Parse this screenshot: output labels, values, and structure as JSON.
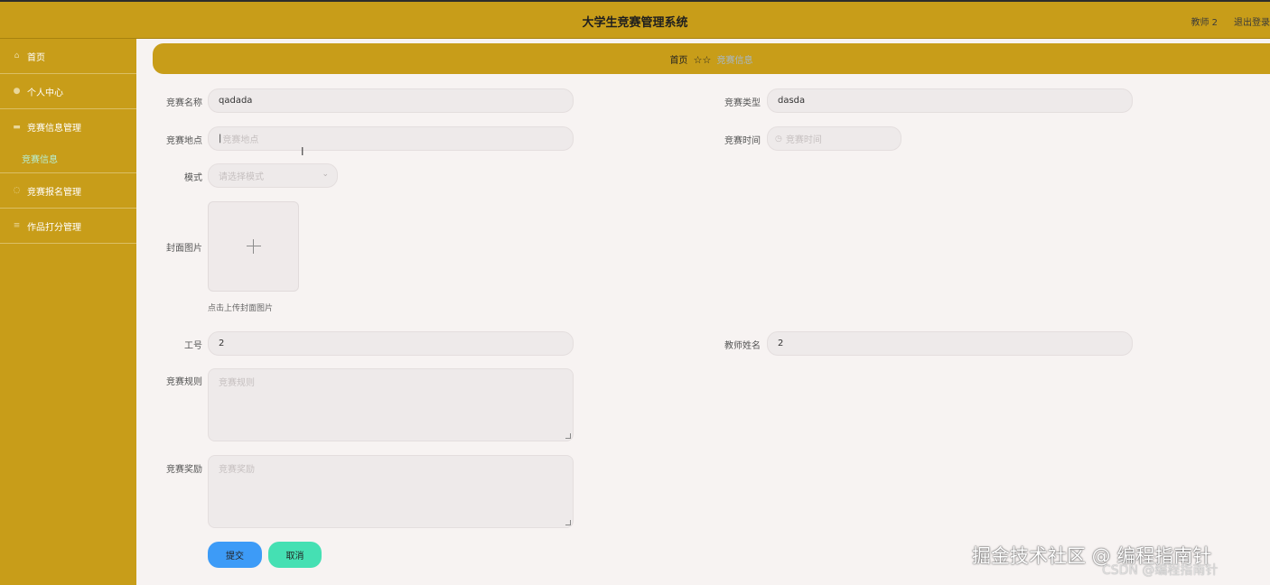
{
  "header": {
    "title": "大学生竞赛管理系统",
    "user": "教师 2",
    "logout": "退出登录"
  },
  "sidebar": {
    "items": [
      {
        "label": "首页",
        "icon": "home-icon"
      },
      {
        "label": "个人中心",
        "icon": "user-icon"
      },
      {
        "label": "竞赛信息管理",
        "icon": "list-icon"
      },
      {
        "label": "竞赛信息",
        "icon": ""
      },
      {
        "label": "竞赛报名管理",
        "icon": "clipboard-icon"
      },
      {
        "label": "作品打分管理",
        "icon": "score-icon"
      }
    ]
  },
  "breadcrumb": {
    "home": "首页",
    "separator": "☆☆",
    "current": "竞赛信息"
  },
  "form": {
    "name_label": "竞赛名称",
    "name_value": "qadada",
    "type_label": "竞赛类型",
    "type_value": "dasda",
    "location_label": "竞赛地点",
    "location_placeholder": "竞赛地点",
    "time_label": "竞赛时间",
    "time_placeholder": "竞赛时间",
    "mode_label": "模式",
    "mode_placeholder": "请选择模式",
    "cover_label": "封面图片",
    "cover_tip": "点击上传封面图片",
    "id_label": "工号",
    "id_value": "2",
    "teacher_label": "教师姓名",
    "teacher_value": "2",
    "rules_label": "竞赛规则",
    "rules_placeholder": "竞赛规则",
    "reward_label": "竞赛奖励",
    "reward_placeholder": "竞赛奖励"
  },
  "buttons": {
    "submit": "提交",
    "cancel": "取消"
  },
  "watermark": {
    "main": "掘金技术社区 @ 编程指南针",
    "sub": "CSDN @编程指南针"
  },
  "colors": {
    "theme": "#c89d19",
    "submit": "#3d9bf7",
    "cancel": "#45e0b3",
    "sub_active": "#b7efd2"
  }
}
